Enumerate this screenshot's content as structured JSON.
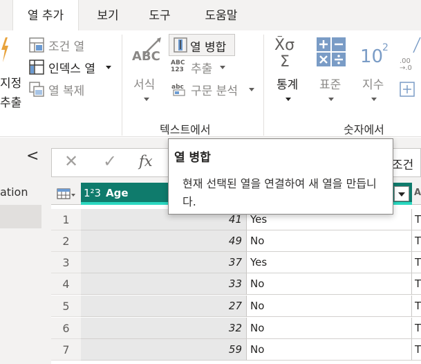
{
  "tabs": [
    {
      "label": "열 추가",
      "active": true
    },
    {
      "label": "보기"
    },
    {
      "label": "도구"
    },
    {
      "label": "도움말"
    }
  ],
  "ribbon": {
    "left_clip": {
      "line1": "지정",
      "line2": "추출"
    },
    "general": {
      "conditional_column": "조건 열",
      "index_column": "인덱스 열",
      "duplicate_column": "열 복제"
    },
    "text": {
      "format": "서식",
      "merge_columns": "열 병합",
      "extract": "추출",
      "parse": "구문 분석",
      "group_label": "텍스트에서"
    },
    "number": {
      "statistics": "통계",
      "standard": "표준",
      "scientific": "지수",
      "group_label": "숫자에서"
    }
  },
  "left_pane": {
    "collapse_glyph": "<",
    "query_label_partial": "ation"
  },
  "formula_bar": {
    "cancel_glyph": "✕",
    "confirm_glyph": "✓",
    "fx_glyph": "fx",
    "formula_partial": "조건"
  },
  "table": {
    "type_glyph": "1²3",
    "age_header": "Age",
    "next_header_partial": "A",
    "rows": [
      {
        "num": "1",
        "age": "41",
        "attr": "Yes",
        "next": "T"
      },
      {
        "num": "2",
        "age": "49",
        "attr": "No",
        "next": "T"
      },
      {
        "num": "3",
        "age": "37",
        "attr": "Yes",
        "next": "T"
      },
      {
        "num": "4",
        "age": "33",
        "attr": "No",
        "next": "T"
      },
      {
        "num": "5",
        "age": "27",
        "attr": "No",
        "next": "T"
      },
      {
        "num": "6",
        "age": "32",
        "attr": "No",
        "next": "T"
      },
      {
        "num": "7",
        "age": "59",
        "attr": "No",
        "next": "T"
      }
    ]
  },
  "tooltip": {
    "title": "열 병합",
    "body": "현재 선택된 열을 연결하여 새 열을 만듭니다."
  },
  "colors": {
    "accent": "#007a6e",
    "header_teal": "#0f7b6c",
    "tab_bg": "#f3f2f1"
  }
}
